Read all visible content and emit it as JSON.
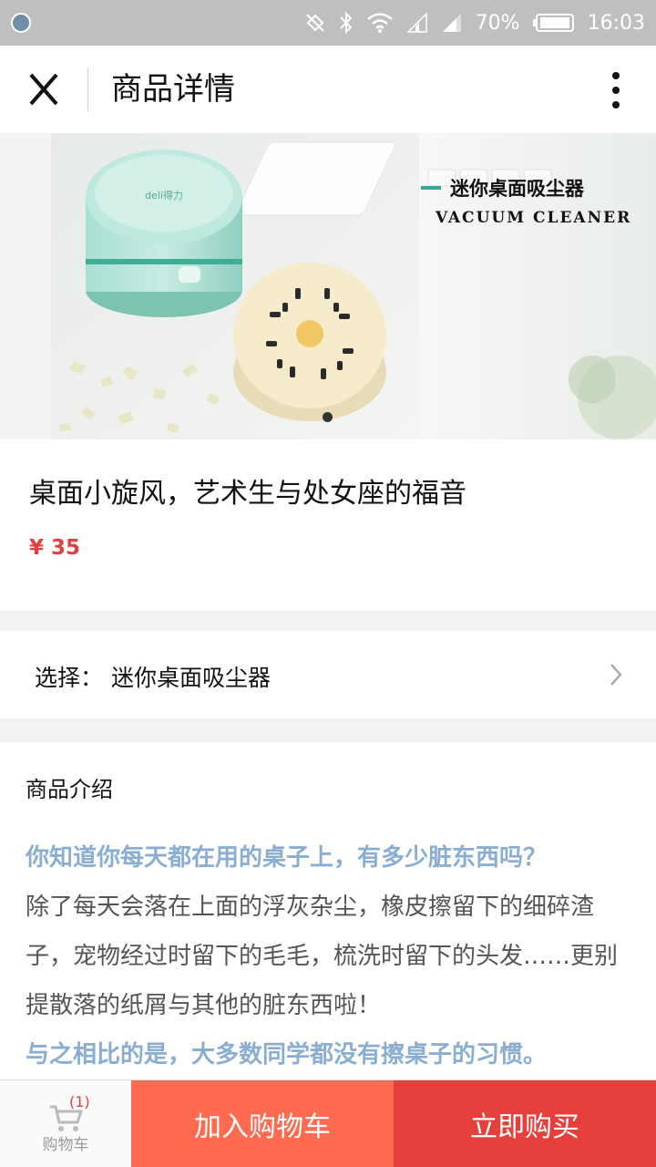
{
  "status_bar": {
    "battery_pct": "70%",
    "time": "16:03"
  },
  "header": {
    "title": "商品详情"
  },
  "hero": {
    "banner_cn": "迷你桌面吸尘器",
    "banner_en": "VACUUM CLEANER",
    "brand_mark": "deli得力"
  },
  "product": {
    "title": "桌面小旋风，艺术生与处女座的福音",
    "price": "¥ 35"
  },
  "option": {
    "label": "选择：",
    "value": "迷你桌面吸尘器"
  },
  "description": {
    "heading": "商品介绍",
    "paragraphs": [
      "你知道你每天都在用的桌子上，有多少脏东西吗？",
      "除了每天会落在上面的浮灰杂尘，橡皮擦留下的细碎渣子，宠物经过时留下的毛毛，梳洗时留下的头发……更别提散落的纸屑与其他的脏东西啦！",
      "与之相比的是，大多数同学都没有擦桌子的习惯。"
    ]
  },
  "bottom_bar": {
    "cart_count": "(1)",
    "cart_label": "购物车",
    "add_to_cart": "加入购物车",
    "buy_now": "立即购买"
  },
  "colors": {
    "price": "#e04040",
    "highlight_text": "#8aaed2",
    "add_to_cart_bg": "#ff6b51",
    "buy_now_bg": "#e5403b"
  }
}
